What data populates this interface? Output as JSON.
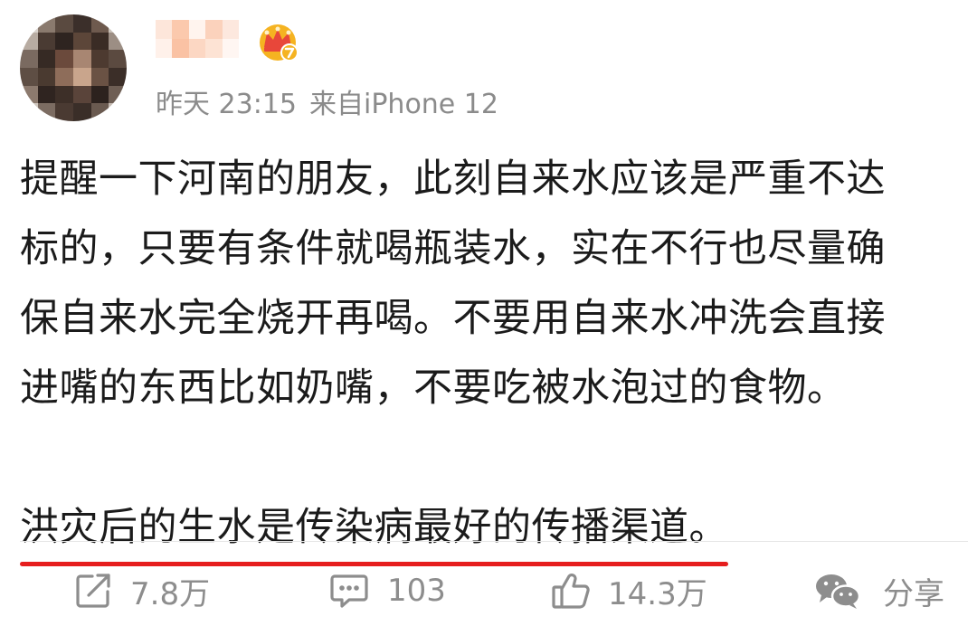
{
  "header": {
    "timestamp": "昨天 23:15",
    "source": "来自iPhone 12"
  },
  "post": {
    "lines": [
      "提醒一下河南的朋友，此刻自来水应该是严重不达",
      "标的，只要有条件就喝瓶装水，实在不行也尽量确",
      "保自来水完全烧开再喝。不要用自来水冲洗会直接",
      "进嘴的东西比如奶嘴，不要吃被水泡过的食物。"
    ],
    "highlight": "洪灾后的生水是传染病最好的传播渠道。"
  },
  "actions": {
    "repost_count": "7.8万",
    "comment_count": "103",
    "like_count": "14.3万",
    "share_label": "分享"
  },
  "icons": {
    "vip_badge": "crown-badge-icon",
    "repost": "repost-icon",
    "comment": "comment-icon",
    "like": "thumbs-up-icon",
    "share": "wechat-share-icon"
  },
  "colors": {
    "underline": "#e61e1e",
    "vip_gold": "#f5b321",
    "vip_red": "#e8473a",
    "meta_text": "#8b8b8b"
  }
}
